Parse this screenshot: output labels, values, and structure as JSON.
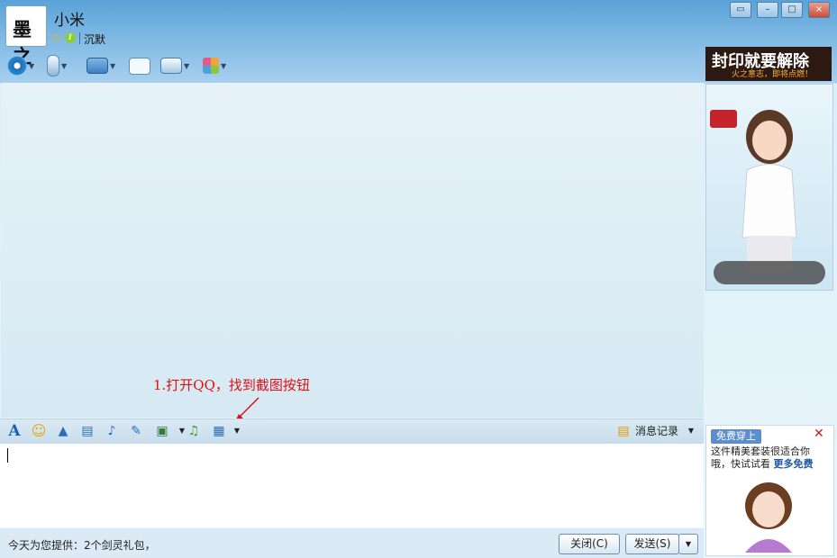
{
  "window": {
    "contact_name": "小米",
    "status": "沉默",
    "avatar_text": "墨之"
  },
  "format_bar": {
    "history_label": "消息记录"
  },
  "annotation": "1.打开QQ，找到截图按钮",
  "bottom": {
    "notice": "今天为您提供：2个剑灵礼包，",
    "close_label": "关闭(C)",
    "send_label": "发送(S)"
  },
  "right_panel": {
    "ad_title": "封印就要解除",
    "ad_subtitle": "火之意志，即将点燃！",
    "promo_tag": "免费穿上",
    "promo_text": "这件精美套装很适合你哦，快试试看",
    "promo_more": "更多免费"
  },
  "colors": {
    "annotation": "#e01010",
    "accent": "#5aa2d8"
  },
  "icons": [
    "video-icon",
    "mic-icon",
    "folder-icon",
    "message-icon",
    "screen-icon",
    "apps-icon",
    "font-icon",
    "emoji-icon",
    "shake-icon",
    "magic-icon",
    "voice-icon",
    "note-icon",
    "image-icon",
    "music-icon",
    "screenshot-icon",
    "history-icon"
  ]
}
